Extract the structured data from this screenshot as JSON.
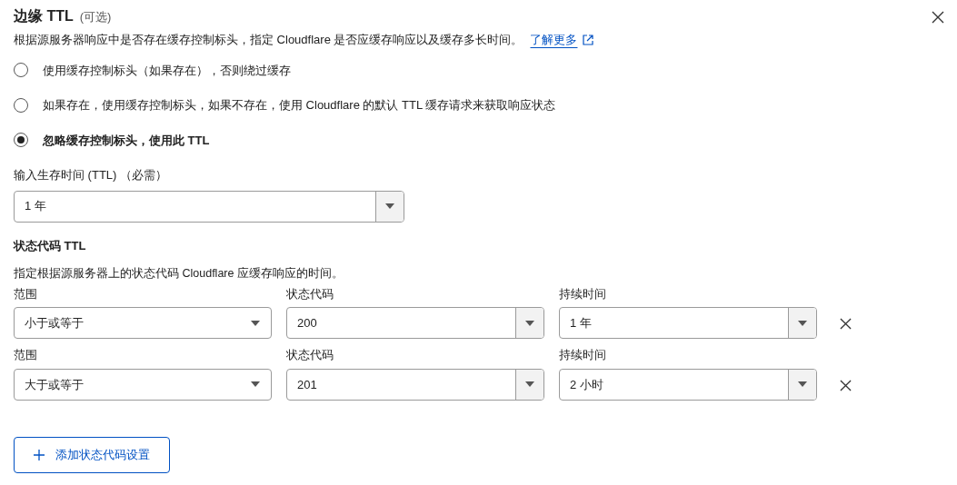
{
  "header": {
    "title": "边缘 TTL",
    "optional": "(可选)",
    "description": "根据源服务器响应中是否存在缓存控制标头，指定 Cloudflare 是否应缓存响应以及缓存多长时间。",
    "link": "了解更多"
  },
  "options": [
    {
      "label": "使用缓存控制标头（如果存在），否则绕过缓存",
      "selected": false
    },
    {
      "label": "如果存在，使用缓存控制标头，如果不存在，使用 Cloudflare 的默认 TTL 缓存请求来获取响应状态",
      "selected": false
    },
    {
      "label": "忽略缓存控制标头，使用此 TTL",
      "selected": true
    }
  ],
  "ttl": {
    "label": "输入生存时间 (TTL) （必需）",
    "value": "1 年"
  },
  "status_section": {
    "title": "状态代码 TTL",
    "description": "指定根据源服务器上的状态代码 Cloudflare 应缓存响应的时间。"
  },
  "rows": [
    {
      "fields": [
        {
          "kind": "plain",
          "label": "范围",
          "value": "小于或等于"
        },
        {
          "kind": "combo",
          "label": "状态代码",
          "value": "200"
        },
        {
          "kind": "combo",
          "label": "持续时间",
          "value": "1 年"
        }
      ]
    },
    {
      "fields": [
        {
          "kind": "plain",
          "label": "范围",
          "value": "大于或等于"
        },
        {
          "kind": "combo",
          "label": "状态代码",
          "value": "201"
        },
        {
          "kind": "combo",
          "label": "持续时间",
          "value": "2 小时"
        }
      ]
    }
  ],
  "add_button": "添加状态代码设置"
}
